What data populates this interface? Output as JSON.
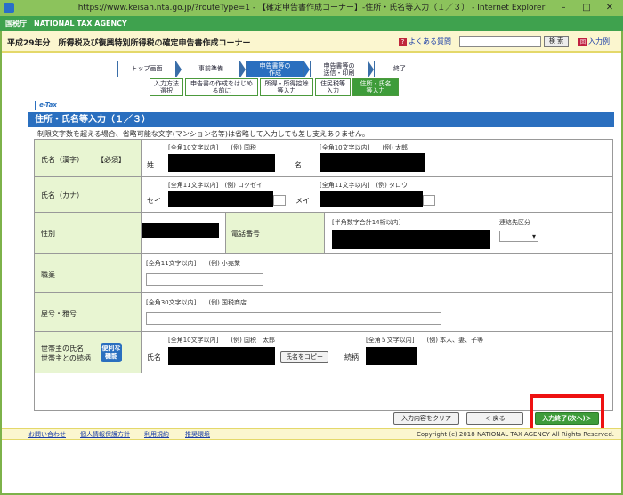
{
  "window": {
    "title": "https://www.keisan.nta.go.jp/?routeType=1 - 【確定申告書作成コーナー】-住所・氏名等入力（１／３） - Internet Explorer",
    "min": "–",
    "max": "□",
    "close": "✕"
  },
  "agency": {
    "name": "国税庁　NATIONAL TAX AGENCY"
  },
  "header": {
    "title": "平成29年分　所得税及び復興特別所得税の確定申告書作成コーナー",
    "faq_icon": "?",
    "faq": "よくある質問",
    "search_button": "検 索",
    "entry_icon": "回",
    "entry": "入力例"
  },
  "steps": [
    {
      "label": "トップ画面"
    },
    {
      "label": "事前準備"
    },
    {
      "label": "申告書等の作成",
      "line1": "申告書等の",
      "line2": "作成"
    },
    {
      "label": "申告書等の送信・印刷",
      "line1": "申告書等の",
      "line2": "送信・印刷"
    },
    {
      "label": "終了"
    }
  ],
  "substeps": [
    {
      "line1": "入力方法",
      "line2": "選択"
    },
    {
      "line1": "申告書の作成をはじめ",
      "line2": "る前に"
    },
    {
      "line1": "所得・所得控除",
      "line2": "等入力"
    },
    {
      "line1": "住民税等",
      "line2": "入力"
    },
    {
      "line1": "住所・氏名",
      "line2": "等入力"
    }
  ],
  "etax": "e-Tax",
  "section": {
    "title": "住所・氏名等入力（１／３）",
    "note": "制限文字数を超える場合、省略可能な文字(マンション名等)は省略して入力しても差し支えありません。"
  },
  "form": {
    "name_kanji": {
      "label": "氏名（漢字）",
      "required": "【必須】",
      "hint_sei": "[全角10文字以内]　　(例) 国税",
      "hint_mei": "[全角10文字以内]　　(例) 太郎",
      "sei": "姓",
      "mei": "名"
    },
    "name_kana": {
      "label": "氏名（カナ）",
      "hint_sei": "[全角11文字以内]　(例) コクゼイ",
      "hint_mei": "[全角11文字以内]　(例) タロウ",
      "sei": "セイ",
      "mei": "メイ"
    },
    "gender": {
      "label": "性別"
    },
    "phone": {
      "label": "電話番号",
      "hint": "[半角数字合計14桁以内]",
      "contact_label": "連絡先区分",
      "contact_value": "▾"
    },
    "occupation": {
      "label": "職業",
      "hint": "[全角11文字以内]　　(例) 小売業"
    },
    "trade_name": {
      "label": "屋号・雅号",
      "hint": "[全角30文字以内]　　(例) 国税商店"
    },
    "householder": {
      "label1": "世帯主の氏名",
      "label2": "世帯主との続柄",
      "benri1": "便利な",
      "benri2": "機能",
      "hint_name": "[全角10文字以内]　　(例) 国税　太郎",
      "hint_rel": "[全角５文字以内]　　(例) 本人、妻、子等",
      "name": "氏名",
      "copy_button": "氏名をコピー",
      "relation": "続柄"
    }
  },
  "buttons": {
    "clear": "入力内容をクリア",
    "back": "＜ 戻る",
    "next": "入力終了(次へ)＞"
  },
  "footer": {
    "contact": "お問い合わせ",
    "privacy": "個人情報保護方針",
    "terms": "利用規約",
    "env": "推奨環境",
    "copyright": "Copyright (c) 2018 NATIONAL TAX AGENCY All Rights Reserved."
  }
}
